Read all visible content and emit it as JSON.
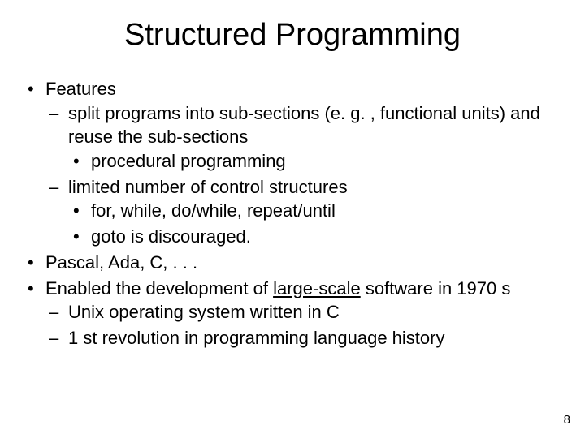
{
  "title": "Structured Programming",
  "bullets": {
    "b1": "Features",
    "b1_1": "split programs into sub-sections (e. g. , functional units) and reuse the sub-sections",
    "b1_1_1": "procedural programming",
    "b1_2": "limited number of control structures",
    "b1_2_1": "for, while, do/while, repeat/until",
    "b1_2_2": "goto is discouraged.",
    "b2": "Pascal, Ada, C, . . .",
    "b3_pre": "Enabled the development of ",
    "b3_u": "large-scale",
    "b3_post": " software in 1970 s",
    "b3_1": "Unix operating system written in C",
    "b3_2": "1 st revolution in programming language history"
  },
  "page_number": "8"
}
